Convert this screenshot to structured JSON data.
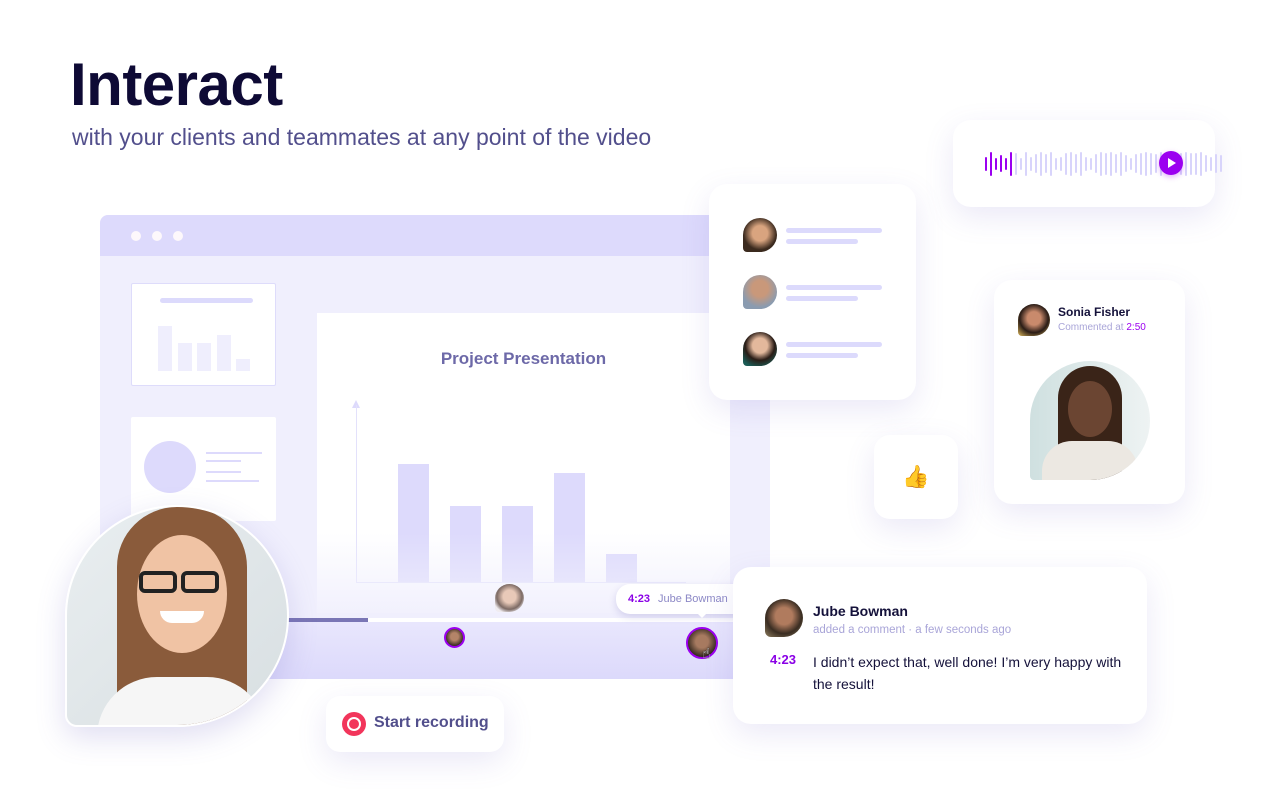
{
  "hero": {
    "title": "Interact",
    "subtitle": "with your clients and teammates at any point of the video"
  },
  "browser": {
    "window_dots": 3,
    "slide": {
      "title": "Project Presentation",
      "bar_values": [
        100,
        64,
        64,
        92,
        24
      ]
    },
    "thumbnail_bar_values": [
      100,
      62,
      62,
      80,
      26
    ]
  },
  "player": {
    "progress_fraction": 0.4,
    "buffered_fraction": 1.0,
    "markers": [
      {
        "name": "teammate-glasses",
        "position_fraction": 0.53
      },
      {
        "name": "jube-bowman-small",
        "position_fraction": 0.46
      },
      {
        "name": "jube-bowman",
        "position_fraction": 0.97
      }
    ],
    "tooltip": {
      "time": "4:23",
      "name": "Jube Bowman"
    },
    "cursor_icon": "hand-pointer-icon"
  },
  "audio_message": {
    "played_fraction": 0.12,
    "play_icon": "play-icon",
    "waveform": [
      0.6,
      1,
      0.5,
      0.7,
      0.5,
      1,
      0.9,
      0.5,
      1,
      0.6,
      0.8,
      1,
      0.8,
      1,
      0.5,
      0.6,
      0.9,
      1,
      0.8,
      1,
      0.6,
      0.5,
      0.8,
      1,
      0.9,
      1,
      0.8,
      1,
      0.7,
      0.5,
      0.8,
      0.9,
      1,
      0.9,
      0.8,
      1,
      0.6,
      0.5,
      0.7,
      0.9,
      1,
      0.9,
      0.9,
      1,
      0.7,
      0.6,
      0.8,
      0.7
    ]
  },
  "participants": [
    {
      "name": "participant-1"
    },
    {
      "name": "participant-2"
    },
    {
      "name": "participant-3"
    }
  ],
  "video_comment": {
    "author": "Sonia Fisher",
    "meta_prefix": "Commented at",
    "time": "2:50"
  },
  "reaction": {
    "emoji": "👍",
    "icon": "thumbs-up-icon"
  },
  "comment": {
    "author": "Jube Bowman",
    "meta": "added a comment · a few seconds ago",
    "time": "4:23",
    "text": "I didn’t expect that, well done! I’m very happy with the result!"
  },
  "record_button": {
    "label": "Start recording",
    "icon": "record-icon"
  },
  "colors": {
    "accent": "#9b00f0",
    "record": "#f2355b",
    "title": "#0e0a35",
    "subtitle": "#524f8c",
    "lavender": "#dddafc"
  }
}
